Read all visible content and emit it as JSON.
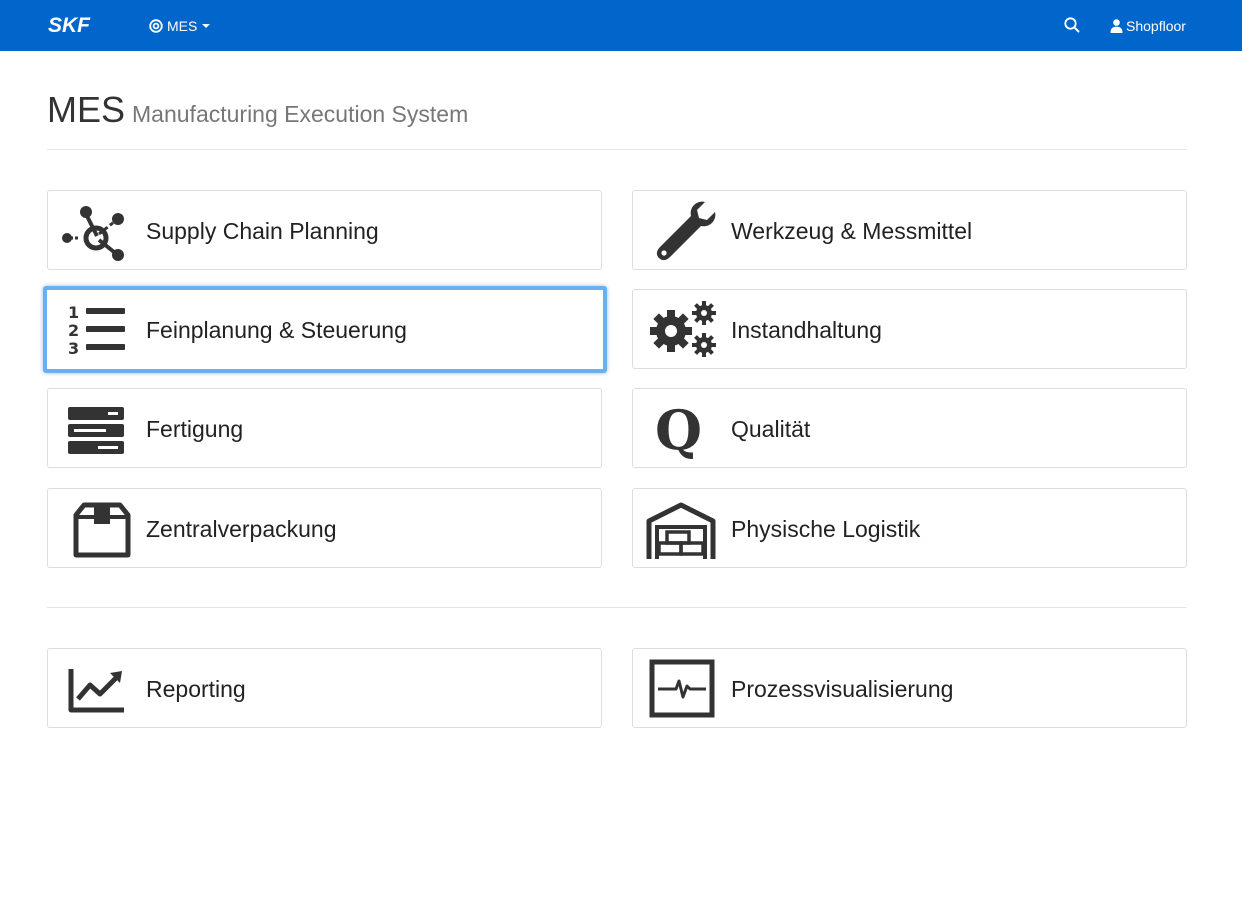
{
  "navbar": {
    "brand": "SKF",
    "menu_label": "MES",
    "search_icon": "search-icon",
    "user_label": "Shopfloor",
    "bg_color": "#0066cc"
  },
  "header": {
    "title": "MES",
    "subtitle": "Manufacturing Execution System"
  },
  "tiles": [
    {
      "label": "Supply Chain Planning",
      "icon": "network-nodes-icon"
    },
    {
      "label": "Werkzeug & Messmittel",
      "icon": "wrench-icon"
    },
    {
      "label": "Feinplanung & Steuerung",
      "icon": "numbered-list-icon",
      "focused": true
    },
    {
      "label": "Instandhaltung",
      "icon": "gears-icon"
    },
    {
      "label": "Fertigung",
      "icon": "server-stack-icon"
    },
    {
      "label": "Qualität",
      "icon": "quality-q-icon"
    },
    {
      "label": "Zentralverpackung",
      "icon": "package-box-icon"
    },
    {
      "label": "Physische Logistik",
      "icon": "warehouse-icon"
    }
  ],
  "bottom_tiles": [
    {
      "label": "Reporting",
      "icon": "line-chart-icon"
    },
    {
      "label": "Prozessvisualisierung",
      "icon": "pulse-monitor-icon"
    }
  ],
  "colors": {
    "accent": "#0066cc",
    "focus_border": "#6aaff0",
    "icon": "#333333"
  }
}
